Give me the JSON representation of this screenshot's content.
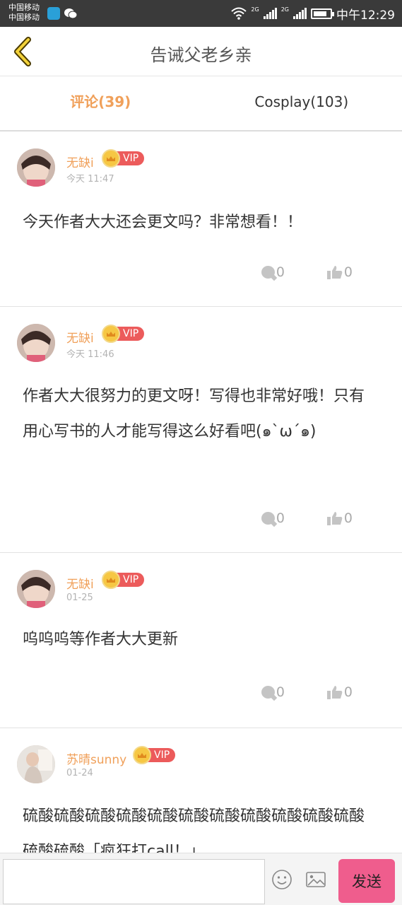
{
  "statusbar": {
    "carrier1": "中国移动",
    "carrier2": "中国移动",
    "net1": "2G",
    "net2": "2G",
    "time": "中午12:29"
  },
  "header": {
    "title": "告诫父老乡亲"
  },
  "tabs": [
    {
      "label": "评论(39)",
      "active": true
    },
    {
      "label": "Cosplay(103)",
      "active": false
    }
  ],
  "comments": [
    {
      "user": "无缺i",
      "vip": "VIP",
      "time": "今天 11:47",
      "text": "今天作者大大还会更文吗？非常想看！！",
      "replies": "0",
      "likes": "0"
    },
    {
      "user": "无缺i",
      "vip": "VIP",
      "time": "今天 11:46",
      "text": "作者大大很努力的更文呀！写得也非常好哦！只有用心写书的人才能写得这么好看吧(๑`ω´๑)",
      "replies": "0",
      "likes": "0"
    },
    {
      "user": "无缺i",
      "vip": "VIP",
      "time": "01-25",
      "text": "呜呜呜等作者大大更新",
      "replies": "0",
      "likes": "0"
    },
    {
      "user": "苏晴sunny",
      "vip": "VIP",
      "time": "01-24",
      "text": "硫酸硫酸硫酸硫酸硫酸硫酸硫酸硫酸硫酸硫酸硫酸硫酸硫酸「疯狂打call！」",
      "replies": "",
      "likes": ""
    }
  ],
  "inputbar": {
    "placeholder": "",
    "send_label": "发送"
  },
  "colors": {
    "accent": "#f0a05a",
    "vip": "#ec5b5b",
    "send": "#ef5d8d"
  }
}
